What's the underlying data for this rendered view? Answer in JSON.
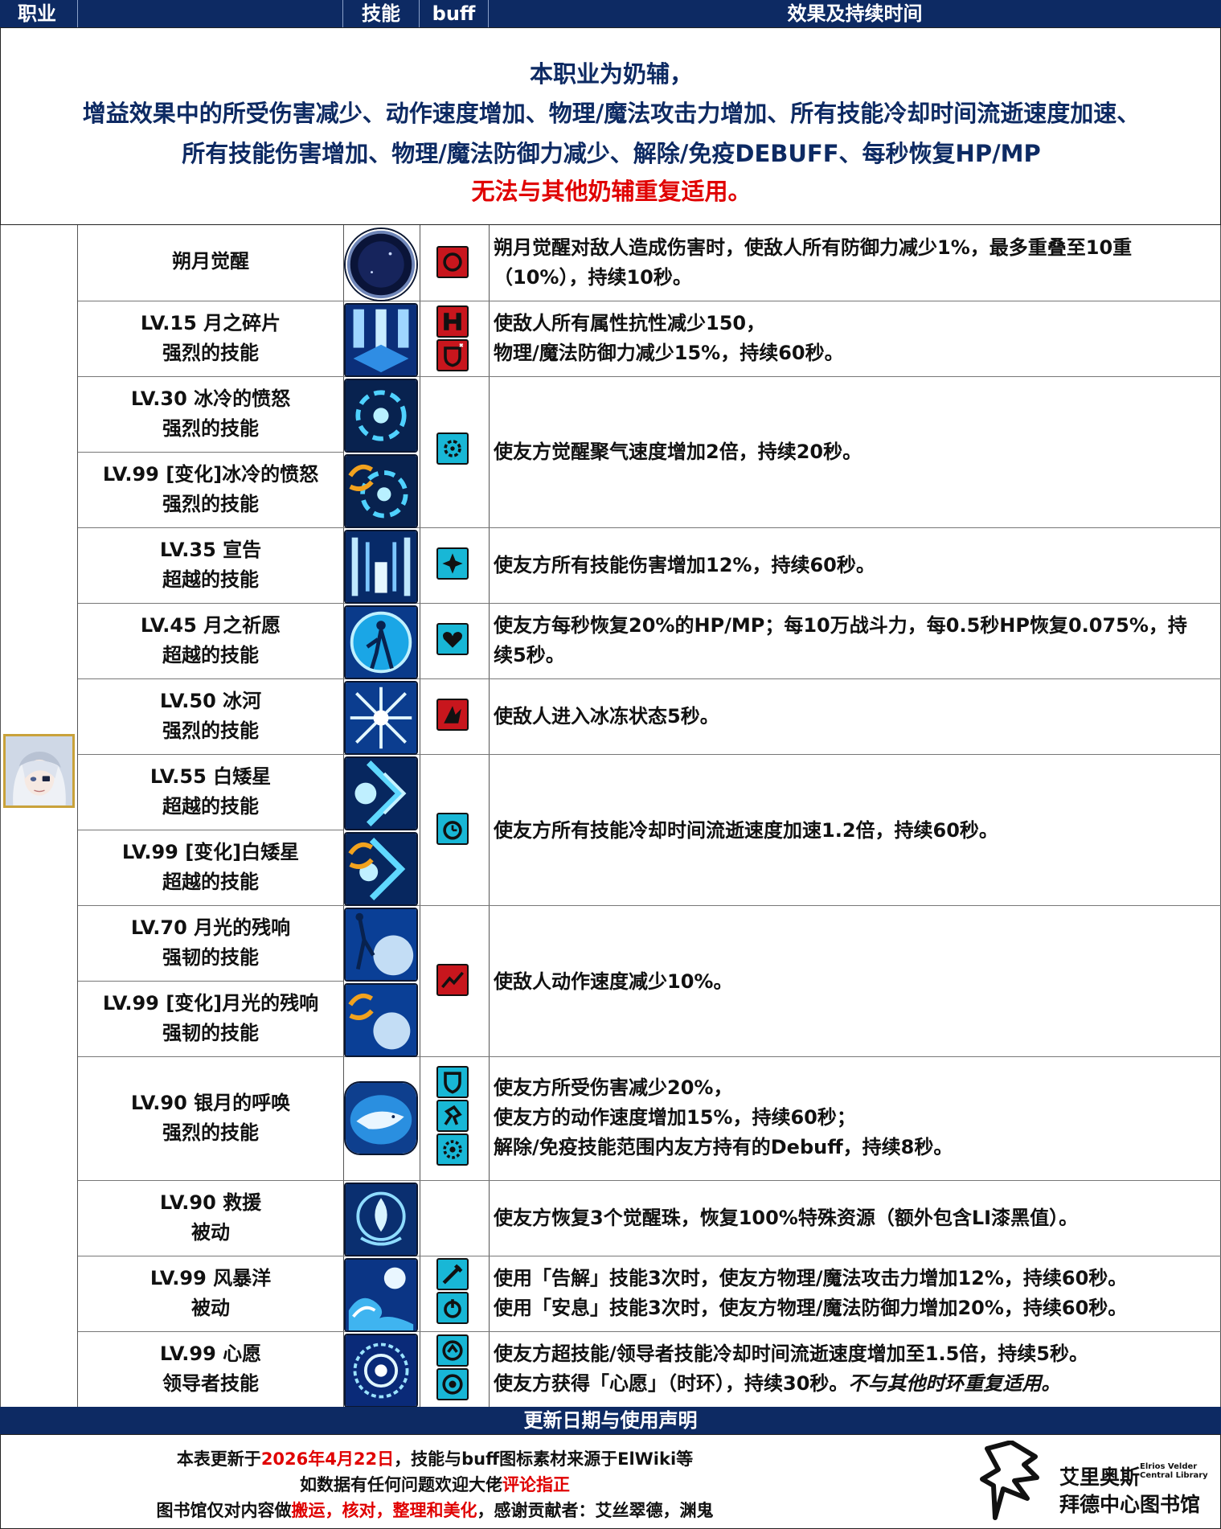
{
  "header": {
    "col_class": "职业",
    "col_skill": "技能",
    "col_buff": "buff",
    "col_effect": "效果及持续时间"
  },
  "intro": {
    "line1": "本职业为奶辅，",
    "line2": "增益效果中的所受伤害减少、动作速度增加、物理/魔法攻击力增加、所有技能冷却时间流逝速度加速、",
    "line3": "所有技能伤害增加、物理/魔法防御力减少、解除/免疫DEBUFF、每秒恢复HP/MP",
    "line4": "无法与其他奶辅重复适用。"
  },
  "skills": [
    {
      "l1": "朔月觉醒",
      "l2": ""
    },
    {
      "l1": "LV.15   月之碎片",
      "l2": "强烈的技能"
    },
    {
      "l1": "LV.30   冰冷的愤怒",
      "l2": "强烈的技能"
    },
    {
      "l1": "LV.99   [变化]冰冷的愤怒",
      "l2": "强烈的技能"
    },
    {
      "l1": "LV.35   宣告",
      "l2": "超越的技能"
    },
    {
      "l1": "LV.45   月之祈愿",
      "l2": "超越的技能"
    },
    {
      "l1": "LV.50   冰河",
      "l2": "强烈的技能"
    },
    {
      "l1": "LV.55   白矮星",
      "l2": "超越的技能"
    },
    {
      "l1": "LV.99   [变化]白矮星",
      "l2": "超越的技能"
    },
    {
      "l1": "LV.70   月光的残响",
      "l2": "强韧的技能"
    },
    {
      "l1": "LV.99   [变化]月光的残响",
      "l2": "强韧的技能"
    },
    {
      "l1": "LV.90   银月的呼唤",
      "l2": "强烈的技能"
    },
    {
      "l1": "LV.90   救援",
      "l2": "被动"
    },
    {
      "l1": "LV.99   风暴洋",
      "l2": "被动"
    },
    {
      "l1": "LV.99   心愿",
      "l2": "领导者技能"
    }
  ],
  "effects": [
    {
      "lines": [
        "朔月觉醒对敌人造成伤害时，使敌人所有防御力减少1%，最多重叠至10重",
        "（10%），持续10秒。"
      ]
    },
    {
      "lines": [
        "使敌人所有属性抗性减少150，",
        "物理/魔法防御力减少15%，持续60秒。"
      ]
    },
    {
      "lines": [
        "使友方觉醒聚气速度增加2倍，持续20秒。"
      ]
    },
    {
      "lines": [
        "使友方所有技能伤害增加12%，持续60秒。"
      ]
    },
    {
      "lines": [
        "使友方每秒恢复20%的HP/MP；每10万战斗力，每0.5秒HP恢复0.075%，持",
        "续5秒。"
      ]
    },
    {
      "lines": [
        "使敌人进入冰冻状态5秒。"
      ]
    },
    {
      "lines": [
        "使友方所有技能冷却时间流逝速度加速1.2倍，持续60秒。"
      ]
    },
    {
      "lines": [
        "使敌人动作速度减少10%。"
      ]
    },
    {
      "lines": [
        "使友方所受伤害减少20%，",
        "使友方的动作速度增加15%，持续60秒；",
        "解除/免疫技能范围内友方持有的Debuff，持续8秒。"
      ]
    },
    {
      "lines": [
        "使友方恢复3个觉醒珠，恢复100%特殊资源（额外包含LI漆黑值）。"
      ]
    },
    {
      "lines": [
        "使用「告解」技能3次时，使友方物理/魔法攻击力增加12%，持续60秒。",
        "使用「安息」技能3次时，使友方物理/魔法防御力增加20%，持续60秒。"
      ]
    },
    {
      "lines": [
        "使友方超技能/领导者技能冷却时间流逝速度增加至1.5倍，持续5秒。"
      ],
      "extra_plain": "使友方获得「心愿」（时环），持续30秒。",
      "extra_italic": "不与其他时环重复适用。"
    }
  ],
  "icons": {
    "skill_icons": [
      "new-moon-icon",
      "moon-shard-icon",
      "cold-fury-icon",
      "cold-fury-changed-icon",
      "declaration-icon",
      "moon-prayer-icon",
      "glacier-icon",
      "white-dwarf-icon",
      "white-dwarf-changed-icon",
      "moonlight-echo-icon",
      "moonlight-echo-changed-icon",
      "silver-moon-call-icon",
      "rescue-icon",
      "storm-ocean-icon",
      "wish-icon"
    ],
    "buff_red": "#c8161d",
    "buff_cyan": "#18b7d6",
    "header_navy": "#0d2a63",
    "accent_red": "#e00000"
  },
  "footer": {
    "title": "更新日期与使用声明",
    "line1_a": "本表更新于",
    "line1_date": "2026年4月22日",
    "line1_b": "，技能与buff图标素材来源于ElWiki等",
    "line2_a": "如数据有任何问题欢迎大佬",
    "line2_red": "评论指正",
    "line3_a": "图书馆仅对内容做",
    "line3_red": "搬运，核对，整理和美化",
    "line3_b": "，感谢贡献者：艾丝翠德，渊鬼",
    "lib_name": "艾里奥斯",
    "lib_en": "Elrios Velder Central Library",
    "lib_cn": "拜德中心图书馆"
  }
}
